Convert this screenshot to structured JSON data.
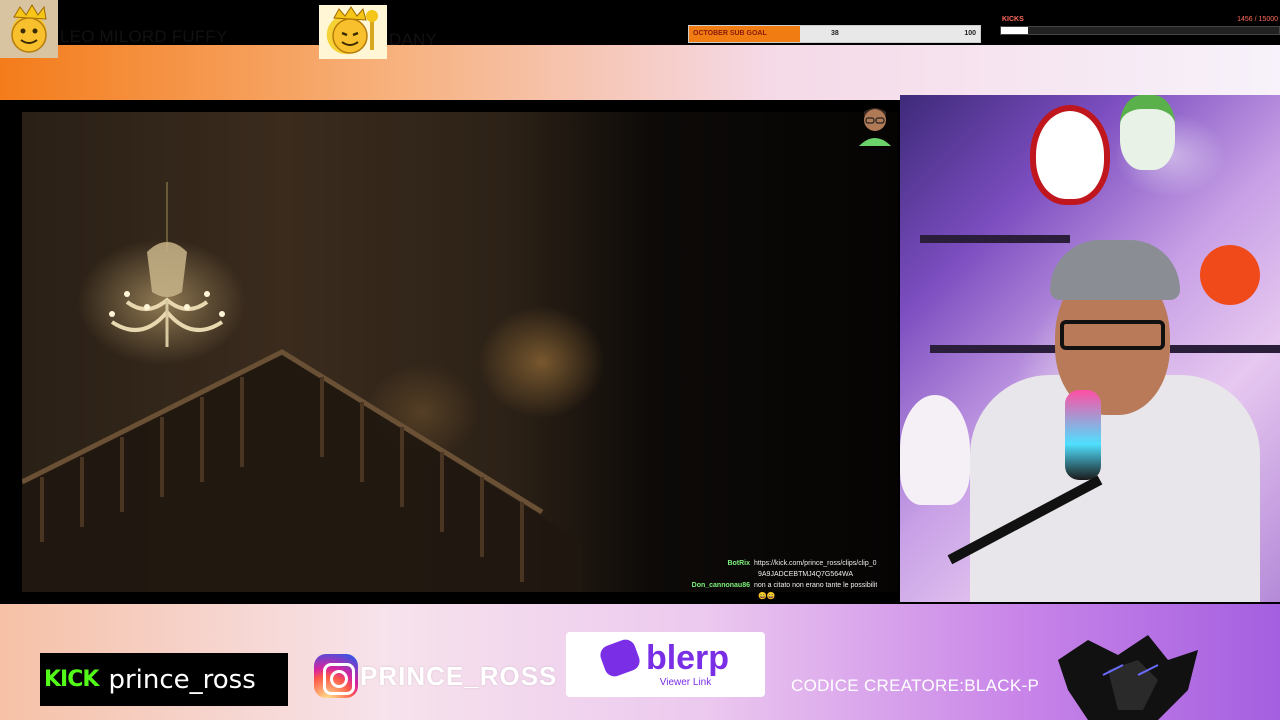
{
  "top_bar": {
    "viewers": [
      {
        "name": "LEO MILORD FUFFY"
      },
      {
        "name": "DANY"
      }
    ],
    "sub_goal": {
      "label": "OCTOBER SUB GOAL",
      "current": "38",
      "target": "100",
      "progress": 0.38,
      "fill_color": "#f07c12"
    },
    "kicks": {
      "label": "KICKS",
      "count": "1456 / 15000",
      "progress": 0.097
    }
  },
  "chat": [
    {
      "user": "BotRix",
      "message": "https://kick.com/prince_ross/clips/clip_0"
    },
    {
      "user": "",
      "message": "9A9JADCEBTMJ4Q7G564WA"
    },
    {
      "user": "Don_cannonau86",
      "message": "non a citato non erano tante le possibilit"
    },
    {
      "user": "",
      "message": "😄😄"
    }
  ],
  "bottom_bar": {
    "kick": {
      "logo": "KICK",
      "handle": "prince_ross",
      "color": "#53fc18"
    },
    "instagram": {
      "handle": "PRINCE_ROSS",
      "icon": "instagram-icon"
    },
    "blerp": {
      "brand": "blerp",
      "subtitle": "Viewer Link",
      "color": "#7a2ee6"
    },
    "creator_code": "CODICE CREATORE:BLACK-P"
  }
}
